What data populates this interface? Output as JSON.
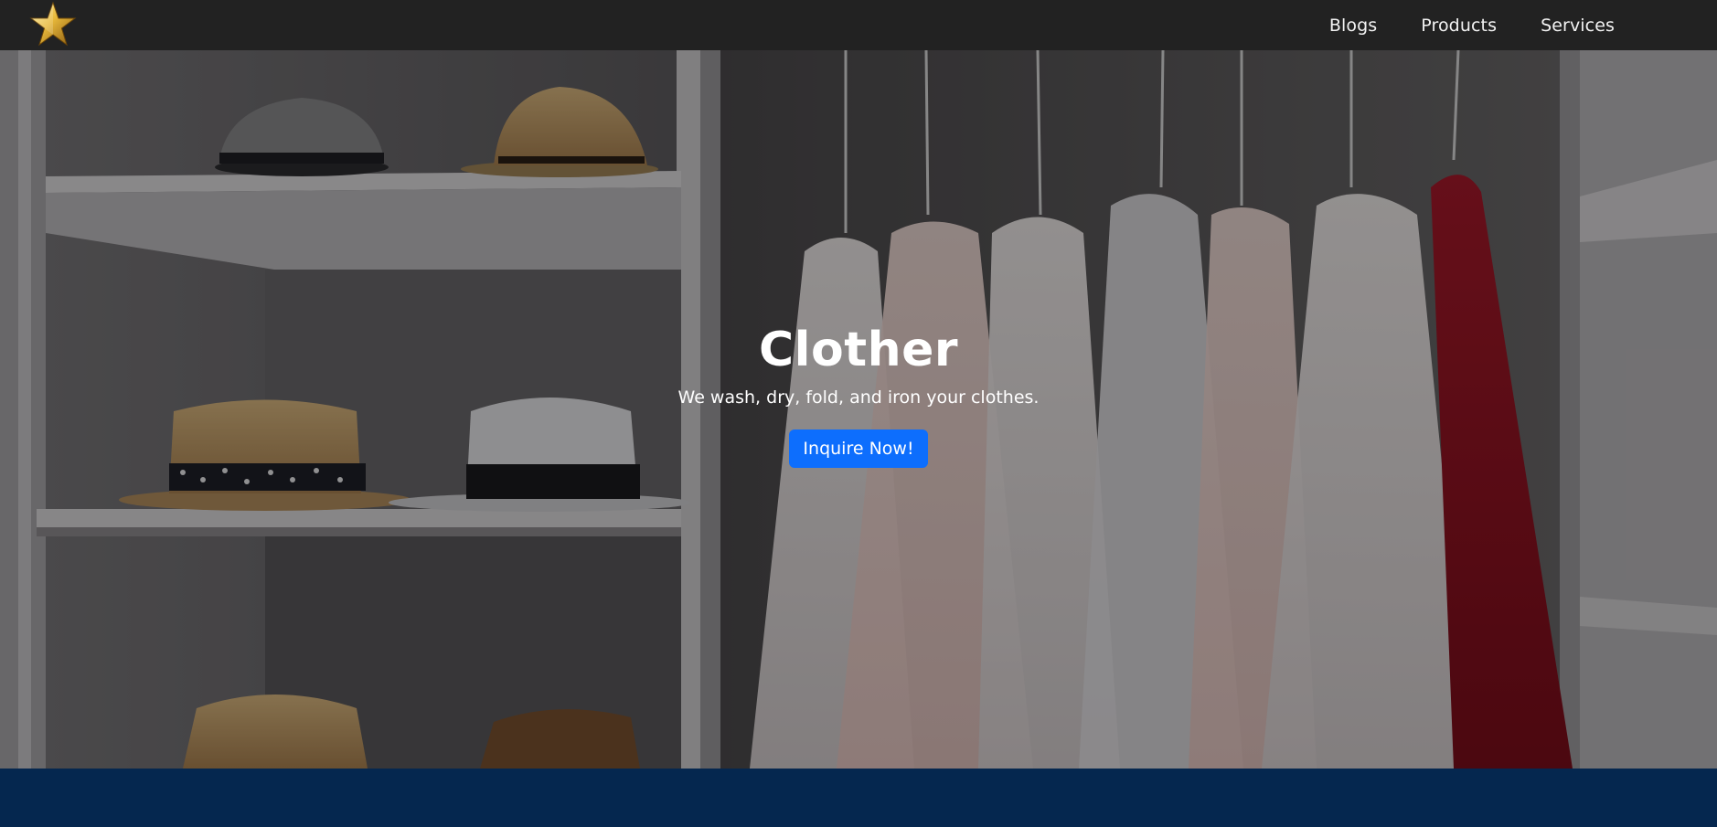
{
  "navbar": {
    "logo_icon": "star-icon",
    "links": [
      {
        "label": "Blogs"
      },
      {
        "label": "Products"
      },
      {
        "label": "Services"
      }
    ],
    "background": "#222222"
  },
  "hero": {
    "title": "Clother",
    "subtitle": "We wash, dry, fold, and iron your clothes.",
    "cta_label": "Inquire Now!",
    "cta_color": "#0d6efd"
  },
  "footer": {
    "background": "#05274f"
  }
}
